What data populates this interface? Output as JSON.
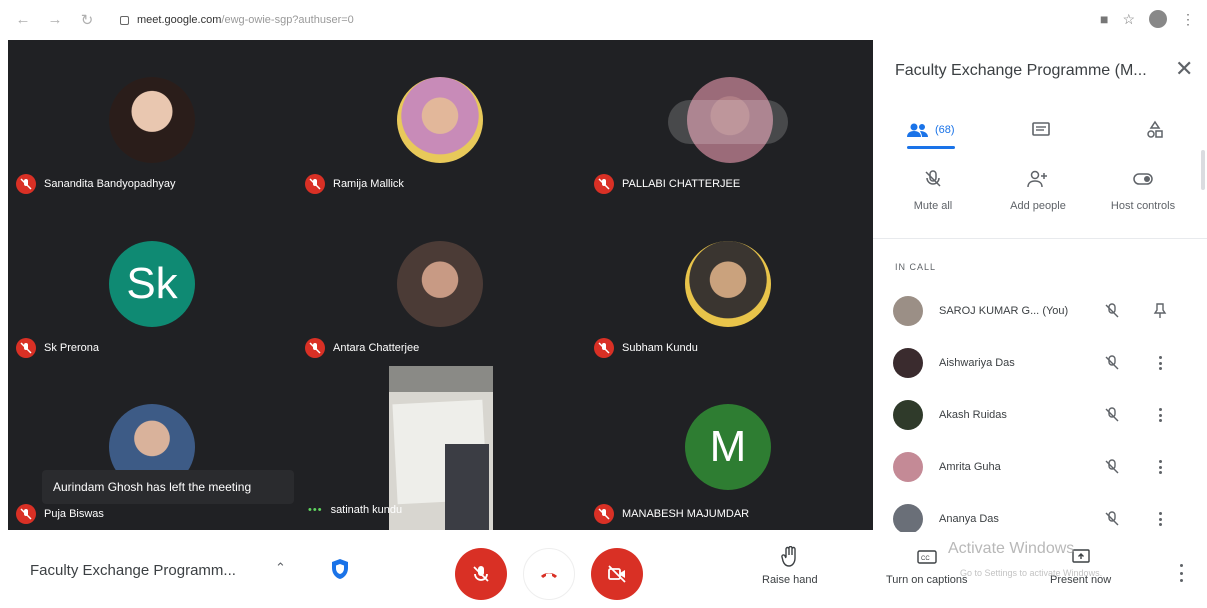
{
  "browser": {
    "url_domain": "meet.google.com",
    "url_path": "/ewg-owie-sgp?authuser=0"
  },
  "tiles": [
    {
      "name": "Sanandita Bandyopadhyay",
      "kind": "photo"
    },
    {
      "name": "Ramija Mallick",
      "kind": "photo"
    },
    {
      "name": "PALLABI CHATTERJEE",
      "kind": "photo"
    },
    {
      "name": "Sk Prerona",
      "kind": "letter",
      "letter": "Sk",
      "color": "#0f8a73"
    },
    {
      "name": "Antara Chatterjee",
      "kind": "photo"
    },
    {
      "name": "Subham Kundu",
      "kind": "photo"
    },
    {
      "name": "Puja Biswas",
      "kind": "photo"
    },
    {
      "name": "satinath kundu",
      "kind": "video"
    },
    {
      "name": "MANABESH MAJUMDAR",
      "kind": "letter",
      "letter": "M",
      "color": "#2e7d32"
    }
  ],
  "toast": "Aurindam Ghosh has left the meeting",
  "panel": {
    "title": "Faculty Exchange Programme (M...",
    "tabs": {
      "people_count": "(68)"
    },
    "actions": {
      "mute_all": "Mute all",
      "add_people": "Add people",
      "host_controls": "Host controls"
    },
    "section_label": "IN CALL",
    "participants": [
      {
        "name": "SAROJ KUMAR G...",
        "suffix": "(You)",
        "color": "#9b8f86"
      },
      {
        "name": "Aishwariya Das",
        "color": "#3a2b2e"
      },
      {
        "name": "Akash Ruidas",
        "color": "#2f3a2a"
      },
      {
        "name": "Amrita Guha",
        "color": "#c48a96"
      },
      {
        "name": "Ananya Das",
        "color": "#6a6f78"
      }
    ]
  },
  "bottombar": {
    "meeting_title": "Faculty Exchange Programm...",
    "raise_hand": "Raise hand",
    "captions": "Turn on captions",
    "present": "Present now",
    "watermark": "Activate Windows",
    "watermark_sub": "Go to Settings to activate Windows."
  }
}
